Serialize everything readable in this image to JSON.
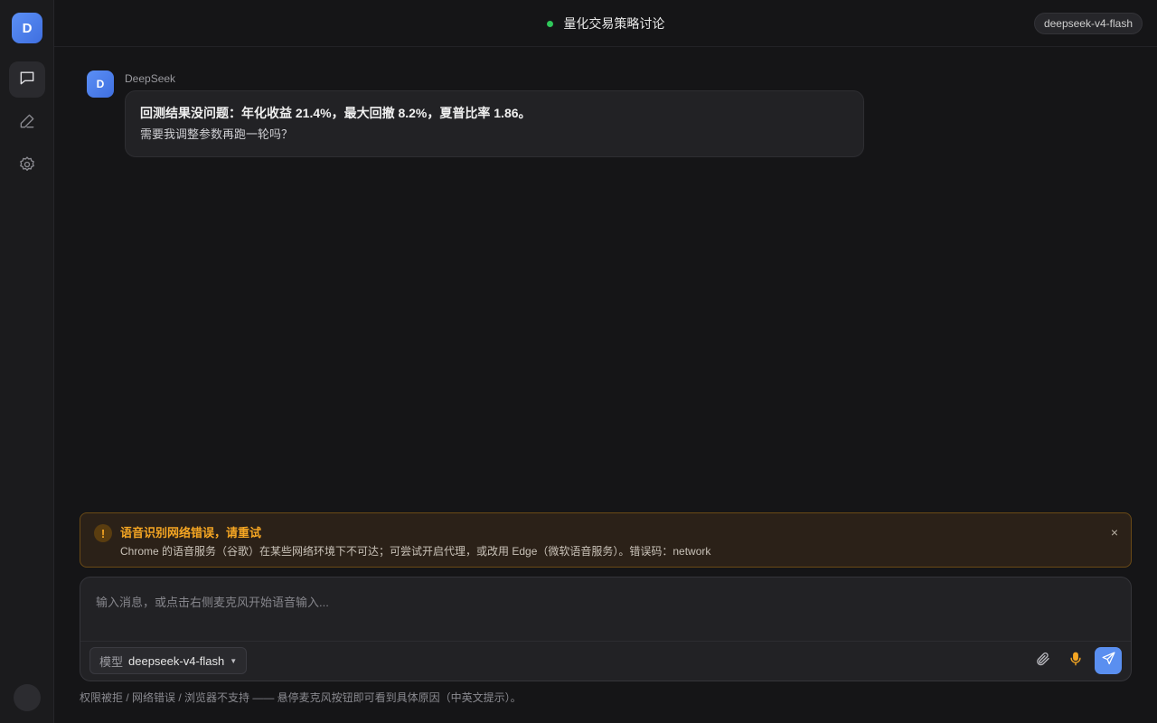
{
  "sidebar": {
    "logo_letter": "D",
    "items": [
      {
        "icon": "chat-icon",
        "active": true
      },
      {
        "icon": "pen-icon",
        "active": false
      },
      {
        "icon": "gear-icon",
        "active": false
      }
    ]
  },
  "header": {
    "title": "量化交易策略讨论",
    "status_color": "#2fc75a",
    "model_badge": "deepseek-v4-flash"
  },
  "message": {
    "avatar_letter": "D",
    "author": "DeepSeek",
    "line1": "回测结果没问题：年化收益 21.4%，最大回撤 8.2%，夏普比率 1.86。",
    "line2": "需要我调整参数再跑一轮吗？"
  },
  "warning": {
    "icon": "!",
    "title": "语音识别网络错误，请重试",
    "detail": "Chrome 的语音服务（谷歌）在某些网络环境下不可达；可尝试开启代理，或改用 Edge（微软语音服务）。错误码：network",
    "close": "×",
    "accent": "#f5a623"
  },
  "composer": {
    "placeholder": "输入消息，或点击右侧麦克风开始语音输入...",
    "model_label": "模型",
    "model_value": "deepseek-v4-flash",
    "send_color": "#5a8ff0"
  },
  "footnote": "权限被拒 / 网络错误 / 浏览器不支持 —— 悬停麦克风按钮即可看到具体原因（中英文提示）。"
}
